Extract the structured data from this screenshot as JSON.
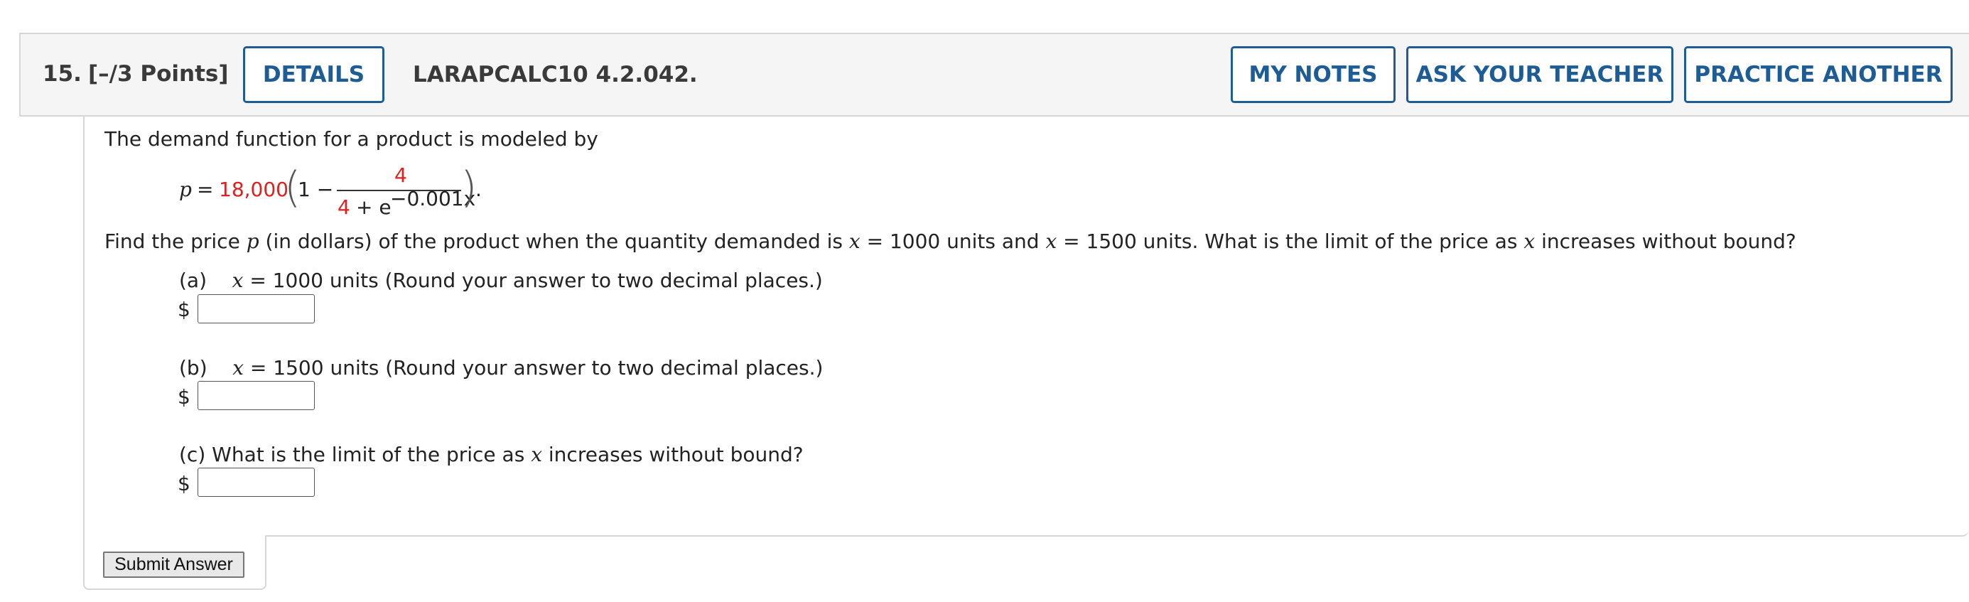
{
  "header": {
    "question_number": "15.",
    "points": "[–/3 Points]",
    "details_label": "DETAILS",
    "assignment_id": "LARAPCALC10 4.2.042.",
    "my_notes_label": "MY NOTES",
    "ask_teacher_label": "ASK YOUR TEACHER",
    "practice_another_label": "PRACTICE ANOTHER"
  },
  "problem": {
    "intro": "The demand function for a product is modeled by",
    "formula": {
      "lhs": "p",
      "equals": "=",
      "coefficient": "18,000",
      "one_minus": "1 −",
      "numerator": "4",
      "denominator_const": "4",
      "denominator_plus": "+ e",
      "exponent": "−0.001x",
      "trailing": "."
    },
    "question_parts": [
      "Find the price ",
      "p",
      " (in dollars) of the product when the quantity demanded is ",
      "x",
      " = 1000 units and ",
      "x",
      " = 1500 units. What is the limit of the price as ",
      "x",
      " increases without bound?"
    ],
    "parts": [
      {
        "label": "(a)",
        "var": "x",
        "rest": " = 1000 units (Round your answer to two decimal places.)",
        "currency": "$",
        "value": ""
      },
      {
        "label": "(b)",
        "var": "x",
        "rest": " = 1500 units (Round your answer to two decimal places.)",
        "currency": "$",
        "value": ""
      },
      {
        "label": "(c)",
        "text_before": " What is the limit of the price as ",
        "var": "x",
        "text_after": " increases without bound?",
        "currency": "$",
        "value": ""
      }
    ]
  },
  "submit_label": "Submit Answer",
  "colors": {
    "accent": "#1d5c94",
    "highlight": "#e01f1f",
    "header_bg": "#f5f5f5",
    "border": "#d6d6d6"
  }
}
